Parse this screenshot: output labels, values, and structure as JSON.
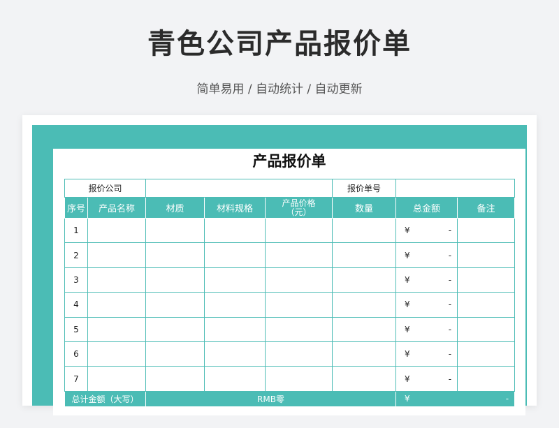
{
  "page": {
    "title": "青色公司产品报价单",
    "subtitle": "简单易用 / 自动统计 / 自动更新"
  },
  "sheet": {
    "title": "产品报价单",
    "info": {
      "company_label": "报价公司",
      "company_value": "",
      "quote_no_label": "报价单号",
      "quote_no_value": ""
    },
    "headers": [
      "序号",
      "产品名称",
      "材质",
      "材料规格",
      "产品价格\n（元）",
      "数量",
      "总金额",
      "备注"
    ],
    "rows": [
      {
        "no": "1",
        "name": "",
        "material": "",
        "spec": "",
        "price": "",
        "qty": "",
        "currency": "¥",
        "amount": "-",
        "note": ""
      },
      {
        "no": "2",
        "name": "",
        "material": "",
        "spec": "",
        "price": "",
        "qty": "",
        "currency": "¥",
        "amount": "-",
        "note": ""
      },
      {
        "no": "3",
        "name": "",
        "material": "",
        "spec": "",
        "price": "",
        "qty": "",
        "currency": "¥",
        "amount": "-",
        "note": ""
      },
      {
        "no": "4",
        "name": "",
        "material": "",
        "spec": "",
        "price": "",
        "qty": "",
        "currency": "¥",
        "amount": "-",
        "note": ""
      },
      {
        "no": "5",
        "name": "",
        "material": "",
        "spec": "",
        "price": "",
        "qty": "",
        "currency": "¥",
        "amount": "-",
        "note": ""
      },
      {
        "no": "6",
        "name": "",
        "material": "",
        "spec": "",
        "price": "",
        "qty": "",
        "currency": "¥",
        "amount": "-",
        "note": ""
      },
      {
        "no": "7",
        "name": "",
        "material": "",
        "spec": "",
        "price": "",
        "qty": "",
        "currency": "¥",
        "amount": "-",
        "note": ""
      }
    ],
    "total": {
      "label": "总计金额（大写）",
      "words": "RMB零",
      "currency": "¥",
      "amount": "-"
    }
  },
  "colors": {
    "accent": "#4bbcb5",
    "background": "#f2f3f5"
  }
}
